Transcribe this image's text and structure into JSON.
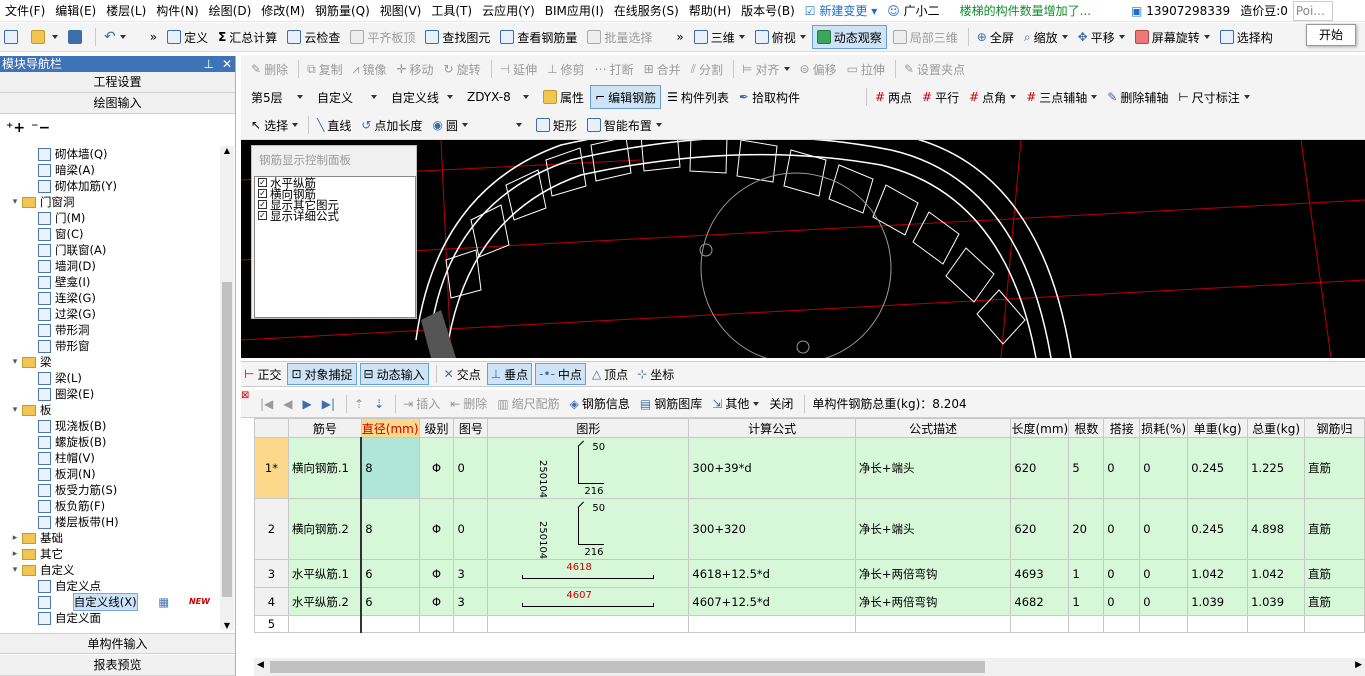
{
  "menubar": {
    "items": [
      "文件(F)",
      "编辑(E)",
      "楼层(L)",
      "构件(N)",
      "绘图(D)",
      "修改(M)",
      "钢筋量(Q)",
      "视图(V)",
      "工具(T)",
      "云应用(Y)",
      "BIM应用(I)",
      "在线服务(S)",
      "帮助(H)",
      "版本号(B)"
    ],
    "new_change": "新建变更",
    "assistant": "广小二",
    "notice": "楼梯的构件数量增加了...",
    "phone": "13907298339",
    "beans": "造价豆:0",
    "poi": "Poi..."
  },
  "popup": {
    "label": "开始"
  },
  "toolbar1": {
    "define": "定义",
    "sum_calc": "汇总计算",
    "cloud_check": "云检查",
    "flat_top": "平齐板顶",
    "find_elem": "查找图元",
    "view_rebar": "查看钢筋量",
    "batch_select": "批量选择",
    "view3d": "三维",
    "top_view": "俯视",
    "dynamic_view": "动态观察",
    "local3d": "局部三维",
    "fullscreen": "全屏",
    "zoom": "缩放",
    "pan": "平移",
    "rotate_screen": "屏幕旋转",
    "select_comp": "选择构"
  },
  "toolbar2": {
    "delete": "删除",
    "copy": "复制",
    "mirror": "镜像",
    "move": "移动",
    "rotate": "旋转",
    "extend": "延伸",
    "trim": "修剪",
    "break": "打断",
    "merge": "合并",
    "split": "分割",
    "align": "对齐",
    "offset": "偏移",
    "stretch": "拉伸",
    "set_grip": "设置夹点"
  },
  "toolbar3": {
    "floor": "第5层",
    "category": "自定义",
    "type": "自定义线",
    "component": "ZDYX-8",
    "props": "属性",
    "edit_rebar": "编辑钢筋",
    "comp_list": "构件列表",
    "pick_comp": "拾取构件",
    "two_points": "两点",
    "parallel": "平行",
    "point_angle": "点角",
    "three_point_aux": "三点辅轴",
    "del_aux": "删除辅轴",
    "dim": "尺寸标注"
  },
  "toolbar4": {
    "select": "选择",
    "line": "直线",
    "point_len": "点加长度",
    "circle": "圆",
    "rect": "矩形",
    "smart_layout": "智能布置"
  },
  "sidebar": {
    "title": "模块导航栏",
    "project_settings": "工程设置",
    "draw_input": "绘图输入",
    "single_input": "单构件输入",
    "report_preview": "报表预览",
    "tree": [
      {
        "level": 2,
        "label": "砌体墙(Q)"
      },
      {
        "level": 2,
        "label": "暗梁(A)"
      },
      {
        "level": 2,
        "label": "砌体加筋(Y)"
      },
      {
        "level": 1,
        "label": "门窗洞",
        "folder": true,
        "open": true
      },
      {
        "level": 2,
        "label": "门(M)"
      },
      {
        "level": 2,
        "label": "窗(C)"
      },
      {
        "level": 2,
        "label": "门联窗(A)"
      },
      {
        "level": 2,
        "label": "墙洞(D)"
      },
      {
        "level": 2,
        "label": "壁龛(I)"
      },
      {
        "level": 2,
        "label": "连梁(G)"
      },
      {
        "level": 2,
        "label": "过梁(G)"
      },
      {
        "level": 2,
        "label": "带形洞"
      },
      {
        "level": 2,
        "label": "带形窗"
      },
      {
        "level": 1,
        "label": "梁",
        "folder": true,
        "open": true
      },
      {
        "level": 2,
        "label": "梁(L)"
      },
      {
        "level": 2,
        "label": "圈梁(E)"
      },
      {
        "level": 1,
        "label": "板",
        "folder": true,
        "open": true
      },
      {
        "level": 2,
        "label": "现浇板(B)"
      },
      {
        "level": 2,
        "label": "螺旋板(B)"
      },
      {
        "level": 2,
        "label": "柱帽(V)"
      },
      {
        "level": 2,
        "label": "板洞(N)"
      },
      {
        "level": 2,
        "label": "板受力筋(S)"
      },
      {
        "level": 2,
        "label": "板负筋(F)"
      },
      {
        "level": 2,
        "label": "楼层板带(H)"
      },
      {
        "level": 1,
        "label": "基础",
        "folder": true,
        "open": false
      },
      {
        "level": 1,
        "label": "其它",
        "folder": true,
        "open": false
      },
      {
        "level": 1,
        "label": "自定义",
        "folder": true,
        "open": true
      },
      {
        "level": 2,
        "label": "自定义点"
      },
      {
        "level": 2,
        "label": "自定义线(X)",
        "selected": true,
        "badge": "NEW"
      },
      {
        "level": 2,
        "label": "自定义面"
      }
    ]
  },
  "control_panel": {
    "title": "钢筋显示控制面板",
    "options": [
      {
        "label": "水平纵筋",
        "checked": true
      },
      {
        "label": "横向钢筋",
        "checked": true
      },
      {
        "label": "显示其它图元",
        "checked": true
      },
      {
        "label": "显示详细公式",
        "checked": true
      }
    ]
  },
  "snapbar": {
    "ortho": "正交",
    "obj_snap": "对象捕捉",
    "dyn_input": "动态输入",
    "intersect": "交点",
    "perp": "垂点",
    "mid": "中点",
    "vertex": "顶点",
    "coord": "坐标"
  },
  "gridbar": {
    "insert": "插入",
    "delete": "删除",
    "scale_rebar": "缩尺配筋",
    "rebar_info": "钢筋信息",
    "rebar_lib": "钢筋图库",
    "other": "其他",
    "close": "关闭",
    "total_weight": "单构件钢筋总重(kg)：8.204"
  },
  "table": {
    "headers": [
      "筋号",
      "直径(mm)",
      "级别",
      "图号",
      "图形",
      "计算公式",
      "公式描述",
      "长度(mm)",
      "根数",
      "搭接",
      "损耗(%)",
      "单重(kg)",
      "总重(kg)",
      "钢筋归"
    ],
    "rows": [
      {
        "no": "1*",
        "name": "横向钢筋.1",
        "dia": "8",
        "grade": "Φ",
        "fig": "0",
        "shape": {
          "kind": "hook",
          "top": "50",
          "side": "250104",
          "bottom": "216"
        },
        "formula": "300+39*d",
        "desc": "净长+端头",
        "len": "620",
        "count": "5",
        "lap": "0",
        "loss": "0",
        "unit_w": "0.245",
        "total_w": "1.225",
        "cat": "直筋"
      },
      {
        "no": "2",
        "name": "横向钢筋.2",
        "dia": "8",
        "grade": "Φ",
        "fig": "0",
        "shape": {
          "kind": "hook",
          "top": "50",
          "side": "250104",
          "bottom": "216"
        },
        "formula": "300+320",
        "desc": "净长+端头",
        "len": "620",
        "count": "20",
        "lap": "0",
        "loss": "0",
        "unit_w": "0.245",
        "total_w": "4.898",
        "cat": "直筋"
      },
      {
        "no": "3",
        "name": "水平纵筋.1",
        "dia": "6",
        "grade": "Φ",
        "fig": "3",
        "shape": {
          "kind": "straight",
          "value": "4618"
        },
        "formula": "4618+12.5*d",
        "desc": "净长+两倍弯钩",
        "len": "4693",
        "count": "1",
        "lap": "0",
        "loss": "0",
        "unit_w": "1.042",
        "total_w": "1.042",
        "cat": "直筋"
      },
      {
        "no": "4",
        "name": "水平纵筋.2",
        "dia": "6",
        "grade": "Φ",
        "fig": "3",
        "shape": {
          "kind": "straight",
          "value": "4607"
        },
        "formula": "4607+12.5*d",
        "desc": "净长+两倍弯钩",
        "len": "4682",
        "count": "1",
        "lap": "0",
        "loss": "0",
        "unit_w": "1.039",
        "total_w": "1.039",
        "cat": "直筋"
      },
      {
        "no": "5",
        "empty": true
      }
    ]
  },
  "colors": {
    "accent": "#3f73b7",
    "row_green": "#d6f7d8",
    "header_orange": "#fbd88a",
    "rebar_red": "#cc0000"
  }
}
